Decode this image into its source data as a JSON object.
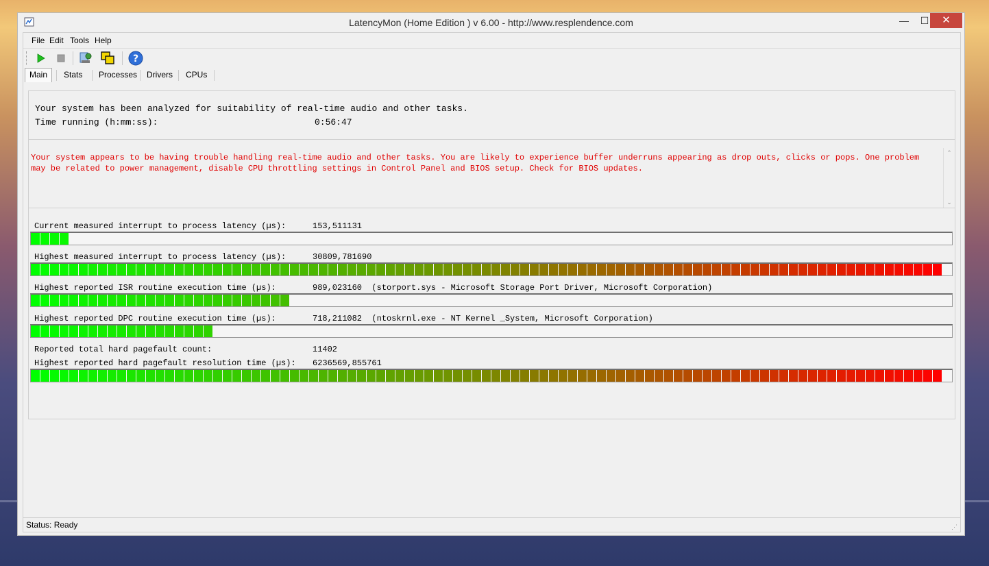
{
  "window": {
    "title": "LatencyMon  (Home Edition )  v 6.00 - http://www.resplendence.com",
    "minimize": "—",
    "maximize": "☐",
    "close": "✕"
  },
  "menu": [
    "File",
    "Edit",
    "Tools",
    "Help"
  ],
  "toolbar": {
    "icons": [
      "play-icon",
      "stop-icon",
      "analyze-icon",
      "windows-icon",
      "help-icon"
    ]
  },
  "tabs": [
    "Main",
    "Stats",
    "Processes",
    "Drivers",
    "CPUs"
  ],
  "analysis": {
    "line1": "Your system has been analyzed for suitability of real-time audio and other tasks.",
    "time_label": "Time running (h:mm:ss):",
    "time_value": "0:56:47"
  },
  "message": "Your system appears to be having trouble handling real-time audio and other tasks. You are likely to experience buffer underruns appearing as drop outs, clicks or pops. One problem may be related to power management, disable CPU throttling settings in Control Panel and BIOS setup. Check for BIOS updates.",
  "metrics": [
    {
      "label": "Current measured interrupt to process latency (µs):",
      "value": "153,511131",
      "level": 0.047
    },
    {
      "label": "Highest measured interrupt to process latency (µs):",
      "value": "30809,781690",
      "level": 1.0
    },
    {
      "label": "Highest reported ISR routine execution time (µs):",
      "value": "989,023160  (storport.sys - Microsoft Storage Port Driver, Microsoft Corporation)",
      "level": 0.285
    },
    {
      "label": "Highest reported DPC routine execution time (µs):",
      "value": "718,211082  (ntoskrnl.exe - NT Kernel _System, Microsoft Corporation)",
      "level": 0.2
    },
    {
      "label": "Reported total hard pagefault count:",
      "value": "11402"
    },
    {
      "label": "Highest reported hard pagefault resolution time (µs):",
      "value": "6236569,855761",
      "level": 1.0
    }
  ],
  "status": "Status: Ready",
  "colors": {
    "bar_start": "#00ff00",
    "bar_mid": "#7a8a00",
    "bar_end": "#ff0000",
    "message_text": "#e00000"
  }
}
